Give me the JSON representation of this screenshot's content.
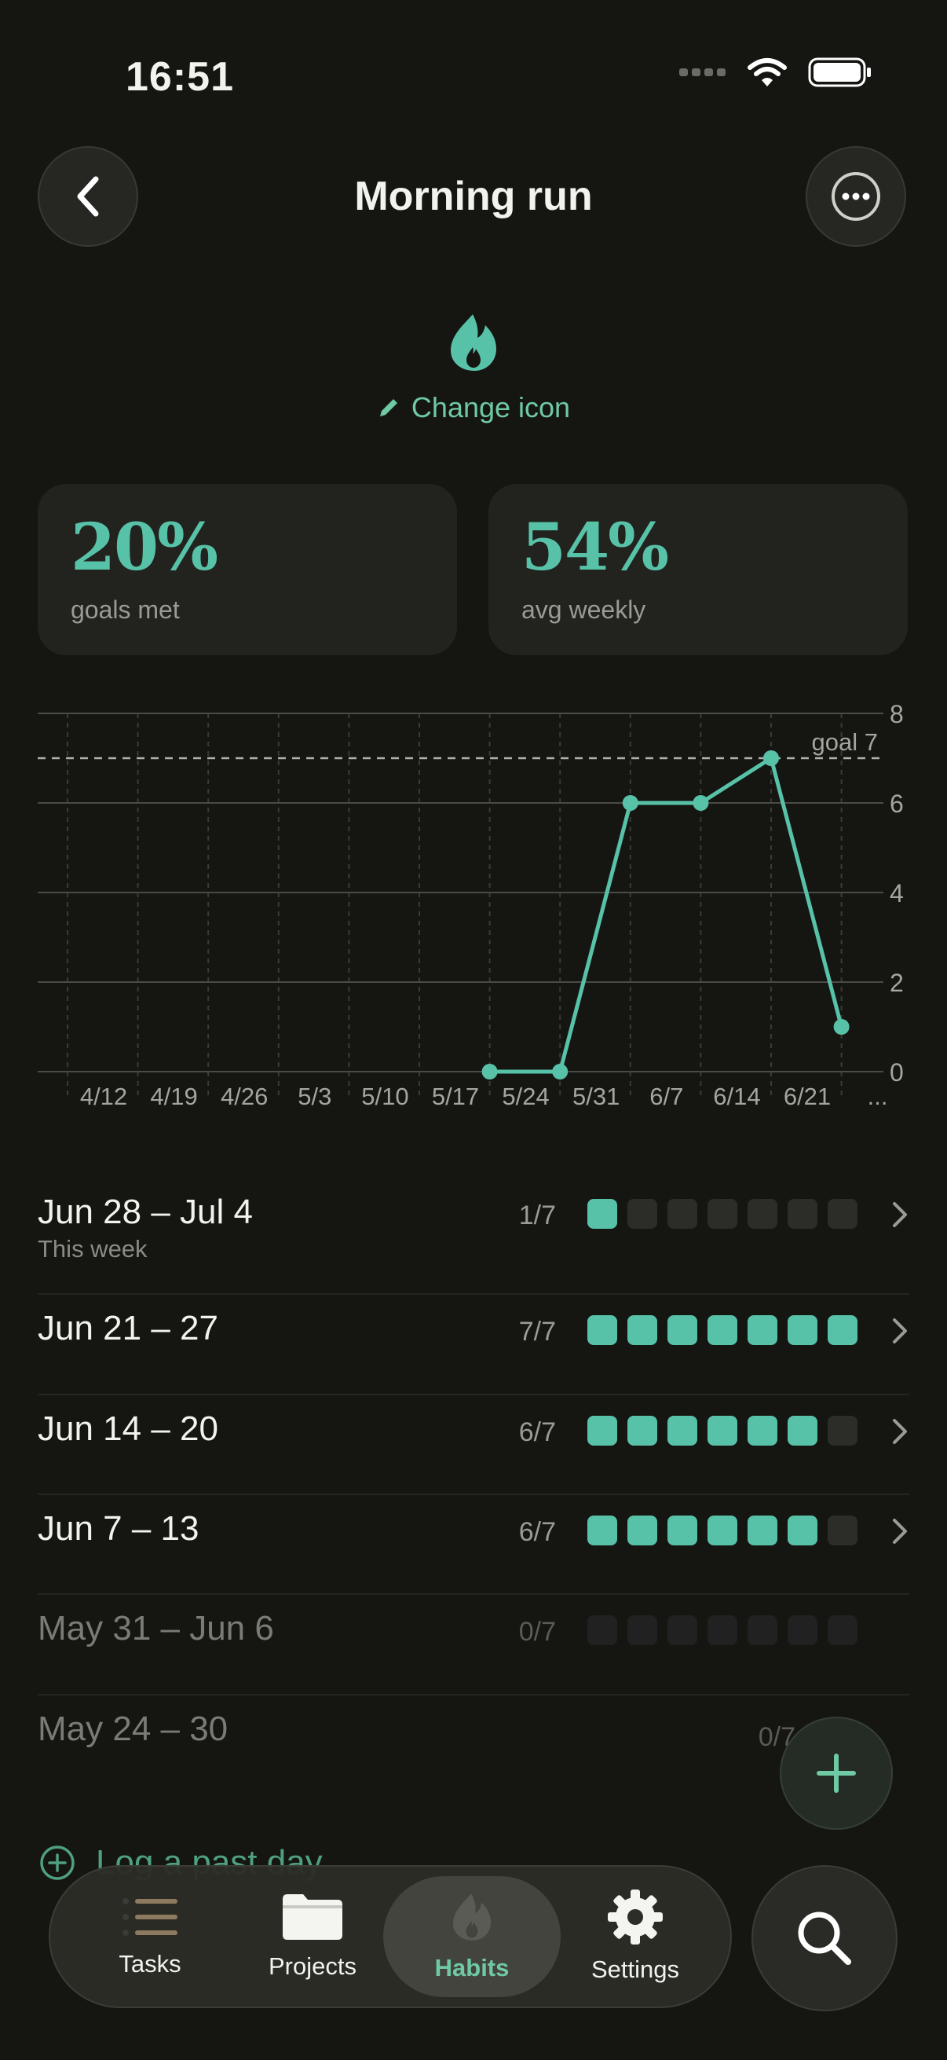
{
  "status_bar": {
    "time": "16:51"
  },
  "header": {
    "title": "Morning run"
  },
  "icon_section": {
    "change_icon_label": "Change icon",
    "habit_icon": "flame-icon"
  },
  "stats": [
    {
      "value": "20%",
      "label": "goals met"
    },
    {
      "value": "54%",
      "label": "avg weekly"
    }
  ],
  "chart_data": {
    "type": "line",
    "x": [
      "4/12",
      "4/19",
      "4/26",
      "5/3",
      "5/10",
      "5/17",
      "5/24",
      "5/31",
      "6/7",
      "6/14",
      "6/21",
      "..."
    ],
    "points": [
      {
        "x": "5/24",
        "y": 0
      },
      {
        "x": "5/31",
        "y": 0
      },
      {
        "x": "6/7",
        "y": 6
      },
      {
        "x": "6/14",
        "y": 6
      },
      {
        "x": "6/21",
        "y": 7
      },
      {
        "x": "...",
        "y": 1
      }
    ],
    "yticks": [
      "0",
      "2",
      "4",
      "6",
      "8"
    ],
    "ylim": [
      0,
      8
    ],
    "goal": {
      "value": 7,
      "label": "goal 7"
    },
    "grid": true,
    "color": "#58c2a8"
  },
  "weeks": [
    {
      "name": "Jun 28 – Jul 4",
      "sub": "This week",
      "count": "1/7",
      "done": [
        1,
        0,
        0,
        0,
        0,
        0,
        0
      ],
      "chevron": true,
      "dim": false
    },
    {
      "name": "Jun 21 – 27",
      "sub": "",
      "count": "7/7",
      "done": [
        1,
        1,
        1,
        1,
        1,
        1,
        1
      ],
      "chevron": true,
      "dim": false
    },
    {
      "name": "Jun 14 – 20",
      "sub": "",
      "count": "6/7",
      "done": [
        1,
        1,
        1,
        1,
        1,
        1,
        0
      ],
      "chevron": true,
      "dim": false
    },
    {
      "name": "Jun 7 – 13",
      "sub": "",
      "count": "6/7",
      "done": [
        1,
        1,
        1,
        1,
        1,
        1,
        0
      ],
      "chevron": true,
      "dim": false
    },
    {
      "name": "May 31 – Jun 6",
      "sub": "",
      "count": "0/7",
      "done": [
        0,
        0,
        0,
        0,
        0,
        0,
        0
      ],
      "chevron": false,
      "dim": true
    },
    {
      "name": "May 24 – 30",
      "sub": "",
      "count": "0/7",
      "done": [],
      "chevron": false,
      "dim": true
    }
  ],
  "log_past": {
    "label": "Log a past day"
  },
  "tabbar": {
    "tabs": [
      {
        "label": "Tasks",
        "icon": "list-icon",
        "active": false
      },
      {
        "label": "Projects",
        "icon": "folder-icon",
        "active": false
      },
      {
        "label": "Habits",
        "icon": "flame-icon",
        "active": true
      },
      {
        "label": "Settings",
        "icon": "gear-icon",
        "active": false
      }
    ]
  },
  "colors": {
    "accent": "#58c2a8",
    "accent_text": "#6fcaa3",
    "background": "#151612",
    "card": "#22231e"
  }
}
